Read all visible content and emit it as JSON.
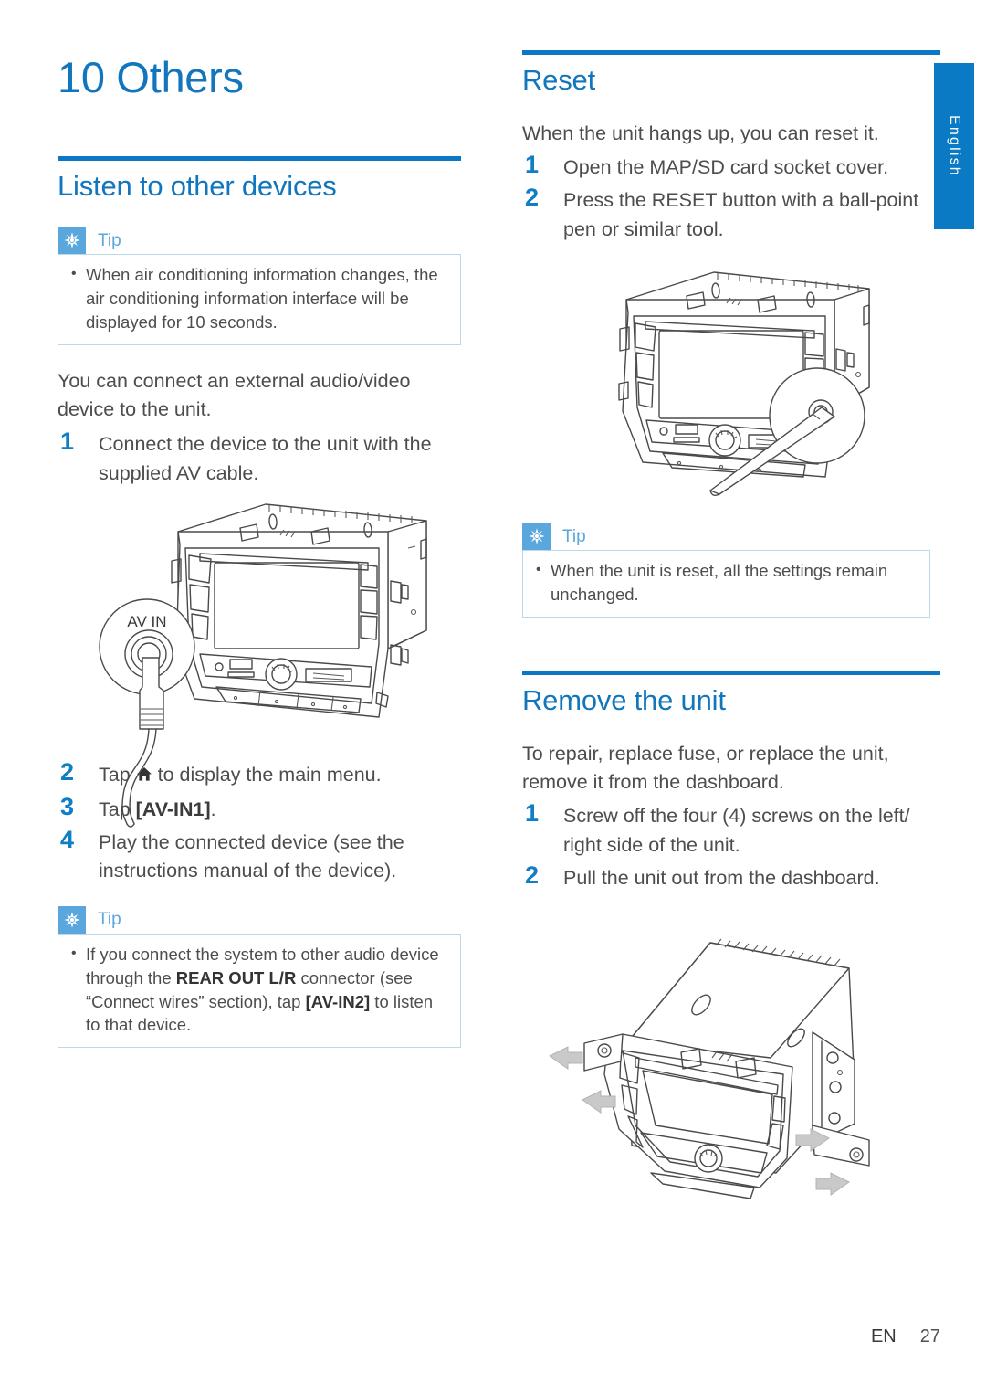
{
  "page": {
    "chapter_number_title": "10 Others",
    "language_tab": "English",
    "footer_lang": "EN",
    "footer_page": "27",
    "accent_blue": "#0c77c4",
    "heading_blue": "#1176bd",
    "tip_blue": "#5aa7dd",
    "tip_border": "#bcd9e8"
  },
  "left_column": {
    "section_title": "Listen to other devices",
    "tip_top": {
      "label": "Tip",
      "icon": "asterisk-flower-icon",
      "items": [
        "When air conditioning information changes, the air conditioning information interface will be displayed for 10 seconds."
      ]
    },
    "intro": "You can connect an external audio/video device to the unit.",
    "steps": [
      {
        "num": "1",
        "text": "Connect the device to the unit with the supplied AV cable."
      },
      {
        "num": "2",
        "text": "Tap ⌂ to display the main menu.",
        "has_home_icon": true,
        "text_before_icon": "Tap ",
        "text_after_icon": " to display the main menu."
      },
      {
        "num": "3",
        "text": "Tap [AV-IN1].",
        "text_before_bold": "Tap ",
        "bold": "[AV-IN1]",
        "text_after_bold": "."
      },
      {
        "num": "4",
        "text": "Play the connected device (see the instructions manual of the device)."
      }
    ],
    "figure_avin": {
      "name": "av-in-connection-illustration",
      "callout_label": "AV IN"
    },
    "tip_bottom": {
      "label": "Tip",
      "icon": "asterisk-flower-icon",
      "item_parts": [
        {
          "text": "If you connect the system to other audio device through the ",
          "bold": false
        },
        {
          "text": "REAR OUT L/R",
          "bold": true
        },
        {
          "text": " connector (see “Connect wires” section), tap ",
          "bold": false
        },
        {
          "text": "[AV-IN2]",
          "bold": true
        },
        {
          "text": " to listen to that device.",
          "bold": false
        }
      ]
    }
  },
  "right_column": {
    "reset": {
      "section_title": "Reset",
      "intro": "When the unit hangs up, you can reset it.",
      "steps": [
        {
          "num": "1",
          "text": "Open the MAP/SD card socket cover."
        },
        {
          "num": "2",
          "text": "Press the RESET button with a ball-point pen or similar tool."
        }
      ],
      "figure": {
        "name": "reset-button-illustration"
      },
      "tip": {
        "label": "Tip",
        "icon": "asterisk-flower-icon",
        "items": [
          "When the unit is reset, all the settings remain unchanged."
        ]
      }
    },
    "remove": {
      "section_title": "Remove the unit",
      "intro": "To repair, replace fuse, or replace the unit, remove it from the dashboard.",
      "steps": [
        {
          "num": "1",
          "text": "Screw off the four (4) screws on the left/ right side of the unit."
        },
        {
          "num": "2",
          "text": "Pull the unit out from the dashboard."
        }
      ],
      "figure": {
        "name": "remove-unit-illustration"
      }
    }
  }
}
